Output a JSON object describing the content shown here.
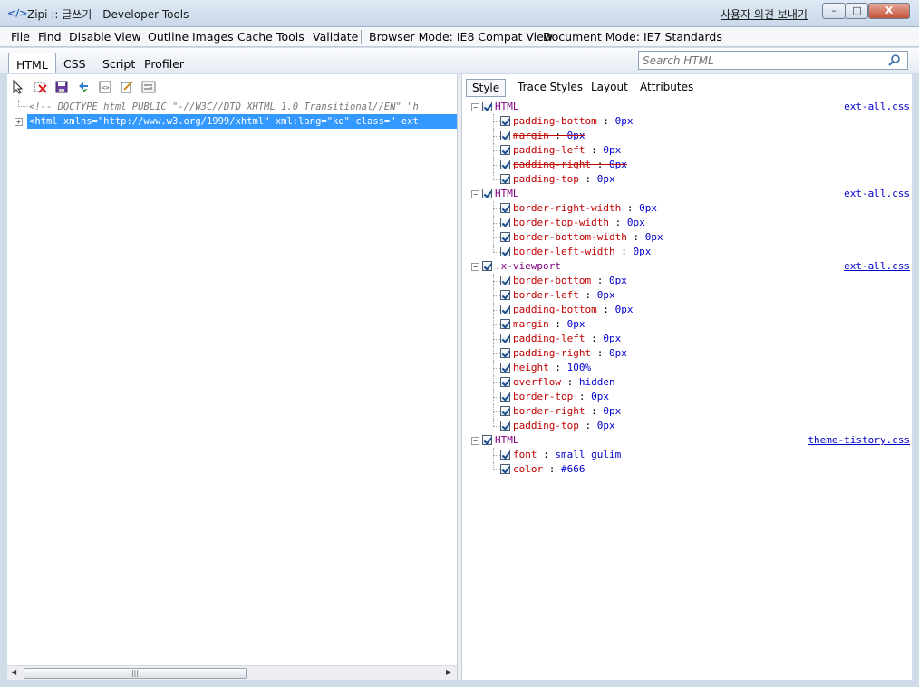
{
  "window": {
    "title": "Zipi :: 글쓰기 - Developer Tools",
    "feedback": "사용자 의견 보내기",
    "minimize": "–",
    "maximize": "□",
    "close": "X"
  },
  "menu": {
    "items": [
      "File",
      "Find",
      "Disable",
      "View",
      "Outline",
      "Images",
      "Cache",
      "Tools",
      "Validate"
    ],
    "browser_mode": "Browser Mode: IE8 Compat View",
    "document_mode": "Document Mode: IE7 Standards"
  },
  "tabs": [
    "HTML",
    "CSS",
    "Script",
    "Profiler"
  ],
  "search": {
    "placeholder": "Search HTML"
  },
  "tree": {
    "doctype": "<!-- DOCTYPE html PUBLIC \"-//W3C//DTD XHTML 1.0 Transitional//EN\" \"h",
    "html_line": "<html xmlns=\"http://www.w3.org/1999/xhtml\" xml:lang=\"ko\" class=\" ext"
  },
  "subtabs": [
    "Style",
    "Trace Styles",
    "Layout",
    "Attributes"
  ],
  "rules": [
    {
      "selector": "HTML",
      "source": "ext-all.css",
      "props": [
        {
          "name": "padding-bottom",
          "value": "0px",
          "overridden": true
        },
        {
          "name": "margin",
          "value": "0px",
          "overridden": true
        },
        {
          "name": "padding-left",
          "value": "0px",
          "overridden": true
        },
        {
          "name": "padding-right",
          "value": "0px",
          "overridden": true
        },
        {
          "name": "padding-top",
          "value": "0px",
          "overridden": true
        }
      ]
    },
    {
      "selector": "HTML",
      "source": "ext-all.css",
      "props": [
        {
          "name": "border-right-width",
          "value": "0px",
          "overridden": false
        },
        {
          "name": "border-top-width",
          "value": "0px",
          "overridden": false
        },
        {
          "name": "border-bottom-width",
          "value": "0px",
          "overridden": false
        },
        {
          "name": "border-left-width",
          "value": "0px",
          "overridden": false
        }
      ]
    },
    {
      "selector": ".x-viewport",
      "source": "ext-all.css",
      "props": [
        {
          "name": "border-bottom",
          "value": "0px",
          "overridden": false
        },
        {
          "name": "border-left",
          "value": "0px",
          "overridden": false
        },
        {
          "name": "padding-bottom",
          "value": "0px",
          "overridden": false
        },
        {
          "name": "margin",
          "value": "0px",
          "overridden": false
        },
        {
          "name": "padding-left",
          "value": "0px",
          "overridden": false
        },
        {
          "name": "padding-right",
          "value": "0px",
          "overridden": false
        },
        {
          "name": "height",
          "value": "100%",
          "overridden": false
        },
        {
          "name": "overflow",
          "value": "hidden",
          "overridden": false
        },
        {
          "name": "border-top",
          "value": "0px",
          "overridden": false
        },
        {
          "name": "border-right",
          "value": "0px",
          "overridden": false
        },
        {
          "name": "padding-top",
          "value": "0px",
          "overridden": false
        }
      ]
    },
    {
      "selector": "HTML",
      "source": "theme-tistory.css",
      "props": [
        {
          "name": "font",
          "value": "small gulim",
          "overridden": false
        },
        {
          "name": "color",
          "value": "#666",
          "overridden": false
        }
      ]
    }
  ]
}
